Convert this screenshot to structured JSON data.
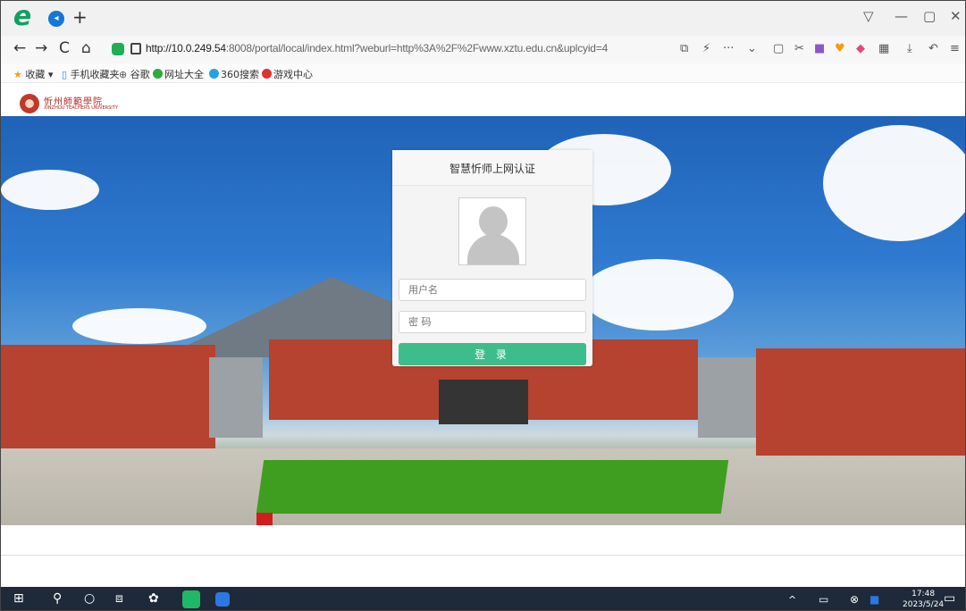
{
  "browser": {
    "newtab_icon": "plus-icon",
    "window_controls": [
      "▽",
      "—",
      "▢",
      "✕"
    ],
    "nav": {
      "back": "←",
      "forward": "→",
      "reload": "C",
      "home": "⌂"
    },
    "url_host": "http://10.0.249.54",
    "url_rest": ":8008/portal/local/index.html?weburl=http%3A%2F%2Fwww.xztu.edu.cn&uplcyid=4",
    "toolbar_icons": [
      "⧉",
      "⚡",
      "···",
      "⌄",
      "▢",
      "✂",
      "■",
      "♥",
      "◆",
      "▦",
      "⤓",
      "↶",
      "≡"
    ]
  },
  "bookmarks": [
    {
      "label": "收藏",
      "icon": "star-icon",
      "color": "#f2a10d"
    },
    {
      "label": "手机收藏夹",
      "icon": "phone-icon",
      "color": "#1c8fe8"
    },
    {
      "label": "谷歌",
      "icon": "globe-icon",
      "color": "#555555"
    },
    {
      "label": "网址大全",
      "icon": "site-icon",
      "color": "#2eaa3e"
    },
    {
      "label": "360搜索",
      "icon": "search360-icon",
      "color": "#27a2df"
    },
    {
      "label": "游戏中心",
      "icon": "game-icon",
      "color": "#e0322d"
    }
  ],
  "site": {
    "school_name": "忻州師範學院",
    "school_sub": "XINZHOU TEACHERS UNIVERSITY"
  },
  "login": {
    "title": "智慧忻师上网认证",
    "username_placeholder": "用户名",
    "password_placeholder": "密 码",
    "submit_label": "登 录",
    "accent": "#3dbd8b"
  },
  "taskbar": {
    "time": "17:48",
    "date": "2023/5/24",
    "tray": [
      "^",
      "▭",
      "⊗",
      "■"
    ]
  }
}
